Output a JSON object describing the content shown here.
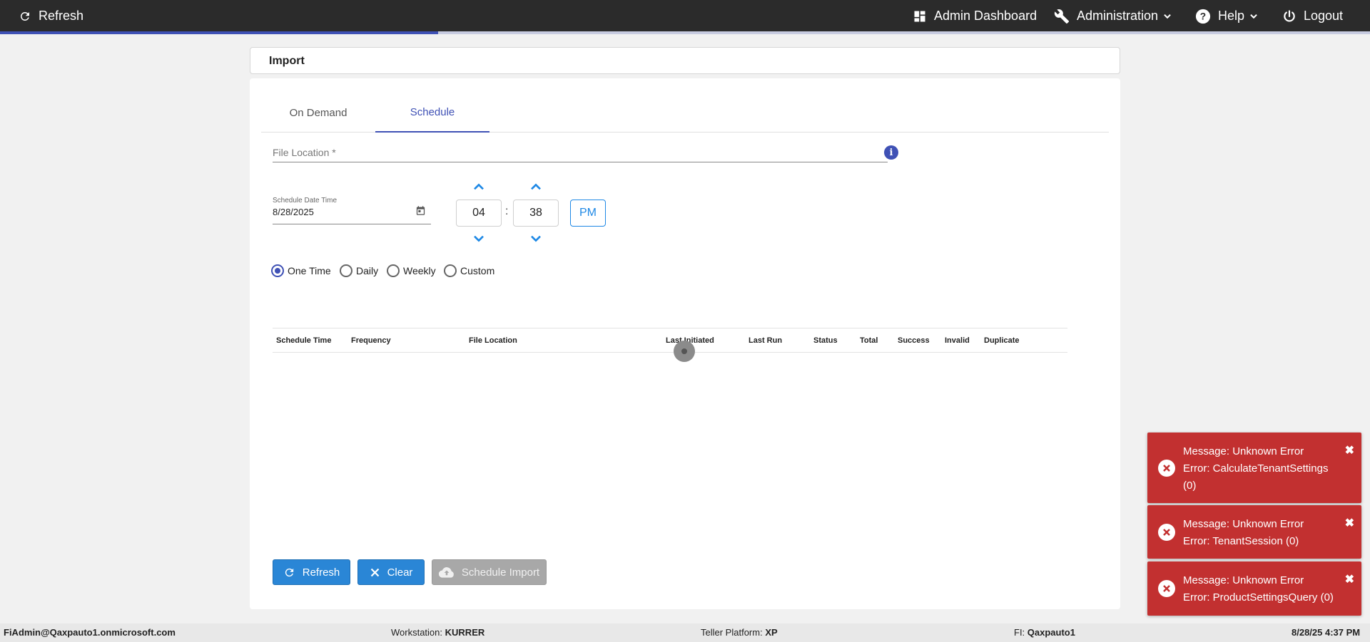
{
  "topbar": {
    "refresh_label": "Refresh",
    "admin_dashboard_label": "Admin Dashboard",
    "administration_label": "Administration",
    "help_label": "Help",
    "logout_label": "Logout",
    "progress_fraction": 0.32
  },
  "page": {
    "title": "Import"
  },
  "tabs": [
    {
      "label": "On Demand",
      "active": false
    },
    {
      "label": "Schedule",
      "active": true
    }
  ],
  "form": {
    "file_location_label": "File Location *",
    "info_icon_glyph": "i",
    "schedule_datetime_label": "Schedule Date Time",
    "schedule_date_value": "8/28/2025",
    "hour_value": "04",
    "minute_value": "38",
    "time_separator": ":",
    "meridian_label": "PM"
  },
  "frequency_options": [
    {
      "label": "One Time",
      "checked": true
    },
    {
      "label": "Daily",
      "checked": false
    },
    {
      "label": "Weekly",
      "checked": false
    },
    {
      "label": "Custom",
      "checked": false
    }
  ],
  "table": {
    "columns": [
      "Schedule Time",
      "Frequency",
      "File Location",
      "Last Initiated",
      "Last Run",
      "Status",
      "Total",
      "Success",
      "Invalid",
      "Duplicate"
    ]
  },
  "buttons": {
    "refresh_label": "Refresh",
    "clear_label": "Clear",
    "schedule_import_label": "Schedule Import"
  },
  "statusbar": {
    "user": "FiAdmin@Qaxpauto1.onmicrosoft.com",
    "workstation_label": "Workstation:",
    "workstation_value": "KURRER",
    "teller_label": "Teller Platform:",
    "teller_value": "XP",
    "fi_label": "FI:",
    "fi_value": "Qaxpauto1",
    "datetime": "8/28/25 4:37 PM"
  },
  "toasts": [
    {
      "line1": "Message: Unknown Error",
      "line2": "Error: CalculateTenantSettings",
      "line3": "(0)"
    },
    {
      "line1": "Message: Unknown Error",
      "line2": "Error: TenantSession (0)"
    },
    {
      "line1": "Message: Unknown Error",
      "line2": "Error: ProductSettingsQuery (0)"
    }
  ],
  "colors": {
    "topbar_bg": "#2b2b2b",
    "accent": "#3f51b5",
    "primary_button": "#2a86d6",
    "toast_error": "#c23030"
  }
}
